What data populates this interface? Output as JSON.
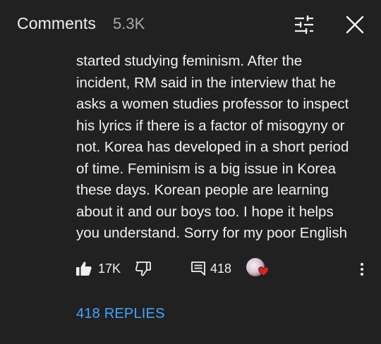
{
  "header": {
    "title": "Comments",
    "count": "5.3K",
    "sort_icon": "sort-sliders-icon",
    "close_icon": "close-icon"
  },
  "comment": {
    "text": "started studying feminism. After the\nincident, RM said in the interview that he\nasks a women studies professor to inspect\nhis lyrics if there is a factor of misogyny or\nnot. Korea has developed in a short period\nof time. Feminism is a big issue in Korea\nthese days. Korean people are learning\nabout it and our boys too. I hope it helps\nyou understand. Sorry for my poor English"
  },
  "actions": {
    "like_count": "17K",
    "reply_count": "418",
    "like_icon": "thumbs-up-filled-icon",
    "dislike_icon": "thumbs-down-icon",
    "reply_icon": "reply-comment-icon",
    "more_icon": "more-vertical-icon"
  },
  "replies": {
    "label": "418 REPLIES"
  },
  "colors": {
    "background": "#212121",
    "text": "#f1f1f1",
    "secondary_text": "#aaaaaa",
    "link": "#3ea6ff",
    "heart": "#e02020"
  }
}
